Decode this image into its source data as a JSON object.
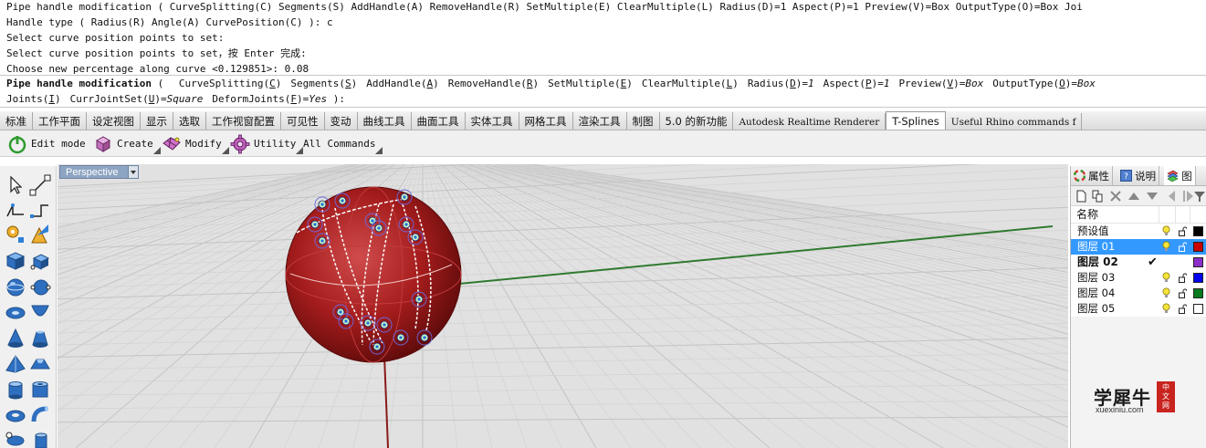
{
  "history": {
    "lines": [
      "Pipe handle modification ( CurveSplitting(C)  Segments(S)  AddHandle(A)  RemoveHandle(R)  SetMultiple(E)  ClearMultiple(L)  Radius(D)=1  Aspect(P)=1  Preview(V)=Box  OutputType(O)=Box  Joi",
      "Handle type ( Radius(R)  Angle(A)  CurvePosition(C) ): c",
      "Select curve position points to set:",
      "Select curve position points to set，按 Enter 完成:",
      "Choose new percentage along curve <0.129851>: 0.08"
    ]
  },
  "prompt": {
    "title": "Pipe handle modification",
    "open": " (",
    "options1": [
      {
        "pre": "CurveSplitting(",
        "key": "C",
        "post": ")",
        "val": ""
      },
      {
        "pre": "Segments(",
        "key": "S",
        "post": ")",
        "val": ""
      },
      {
        "pre": "AddHandle(",
        "key": "A",
        "post": ")",
        "val": ""
      },
      {
        "pre": "RemoveHandle(",
        "key": "R",
        "post": ")",
        "val": ""
      },
      {
        "pre": "SetMultiple(",
        "key": "E",
        "post": ")",
        "val": ""
      },
      {
        "pre": "ClearMultiple(",
        "key": "L",
        "post": ")",
        "val": ""
      },
      {
        "pre": "Radius(",
        "key": "D",
        "post": ")=",
        "val": "1"
      },
      {
        "pre": "Aspect(",
        "key": "P",
        "post": ")=",
        "val": "1"
      },
      {
        "pre": "Preview(",
        "key": "V",
        "post": ")=",
        "val": "Box"
      },
      {
        "pre": "OutputType(",
        "key": "O",
        "post": ")=",
        "val": "Box"
      }
    ],
    "options2": [
      {
        "pre": "Joints(",
        "key": "I",
        "post": ")",
        "val": ""
      },
      {
        "pre": "CurrJointSet(",
        "key": "U",
        "post": ")=",
        "val": "Square"
      },
      {
        "pre": "DeformJoints(",
        "key": "F",
        "post": ")=",
        "val": "Yes"
      }
    ],
    "close": " ):"
  },
  "tabs": [
    {
      "label": "标准"
    },
    {
      "label": "工作平面"
    },
    {
      "label": "设定视图"
    },
    {
      "label": "显示"
    },
    {
      "label": "选取"
    },
    {
      "label": "工作视窗配置"
    },
    {
      "label": "可见性"
    },
    {
      "label": "变动"
    },
    {
      "label": "曲线工具"
    },
    {
      "label": "曲面工具"
    },
    {
      "label": "实体工具"
    },
    {
      "label": "网格工具"
    },
    {
      "label": "渲染工具"
    },
    {
      "label": "制图"
    },
    {
      "label": "5.0 的新功能"
    },
    {
      "label": "Autodesk Realtime Renderer"
    },
    {
      "label": "T-Splines"
    },
    {
      "label": "Useful Rhino commands f"
    }
  ],
  "active_tab": "T-Splines",
  "toolbar": {
    "edit_mode": "Edit mode",
    "create": "Create",
    "modify": "Modify",
    "utility": "Utility",
    "all_commands": "All Commands"
  },
  "viewport": {
    "label": "Perspective"
  },
  "panel": {
    "tabs": [
      {
        "label": "属性",
        "icon": "color-wheel-icon"
      },
      {
        "label": "说明",
        "icon": "help-icon"
      },
      {
        "label": "图",
        "icon": "layers-icon"
      }
    ],
    "column_header": "名称",
    "layers": [
      {
        "name": "预设值",
        "color": "#000000",
        "selected": false,
        "current": false
      },
      {
        "name": "图层 01",
        "color": "#cc0000",
        "selected": true,
        "current": false
      },
      {
        "name": "图层 02",
        "color": "#8b2fc9",
        "selected": false,
        "current": true
      },
      {
        "name": "图层 03",
        "color": "#0000ee",
        "selected": false,
        "current": false
      },
      {
        "name": "图层 04",
        "color": "#0a7a1e",
        "selected": false,
        "current": false
      },
      {
        "name": "图层 05",
        "color": "#ffffff",
        "selected": false,
        "current": false
      }
    ],
    "current_mark": "✔"
  },
  "watermark": {
    "brand": "学犀牛",
    "url": "xuexiniu.com",
    "seal": "中文网"
  }
}
